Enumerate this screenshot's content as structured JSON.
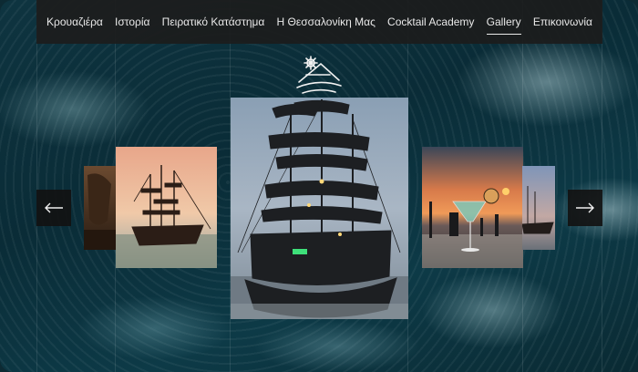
{
  "nav": {
    "items": [
      {
        "label": "Κρουαζιέρα",
        "active": false
      },
      {
        "label": "Ιστορία",
        "active": false
      },
      {
        "label": "Πειρατικό Κατάστημα",
        "active": false
      },
      {
        "label": "Η Θεσσαλονίκη Μας",
        "active": false
      },
      {
        "label": "Cocktail Academy",
        "active": false
      },
      {
        "label": "Gallery",
        "active": true
      },
      {
        "label": "Επικοινωνία",
        "active": false
      }
    ]
  },
  "logo": {
    "icon": "pirate-ship-logo-icon"
  },
  "gallery": {
    "slides": [
      {
        "name": "gallery-slide-far-left",
        "subject": "ship detail"
      },
      {
        "name": "gallery-slide-left",
        "subject": "pirate ship at sunset"
      },
      {
        "name": "gallery-slide-center",
        "subject": "pirate ship at dusk"
      },
      {
        "name": "gallery-slide-right",
        "subject": "cocktail glass at sunset"
      },
      {
        "name": "gallery-slide-far-right",
        "subject": "ship on the sea"
      }
    ],
    "prev_icon": "arrow-left-icon",
    "next_icon": "arrow-right-icon"
  },
  "colors": {
    "nav_bg": "#1c1c1c",
    "nav_text": "#e9e9e9",
    "sea": "#0d3440"
  }
}
